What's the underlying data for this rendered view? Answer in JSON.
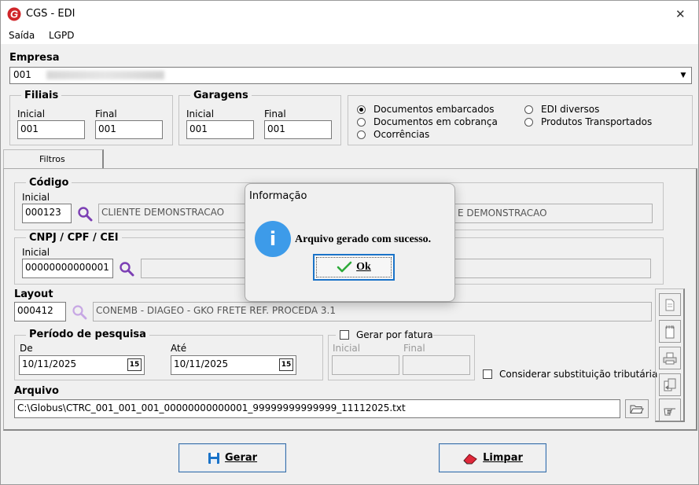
{
  "window": {
    "title": "CGS - EDI",
    "close_glyph": "✕"
  },
  "menu": [
    "Saída",
    "LGPD"
  ],
  "empresa": {
    "label": "Empresa",
    "value": "001"
  },
  "filiais": {
    "title": "Filiais",
    "inicial_label": "Inicial",
    "final_label": "Final",
    "inicial": "001",
    "final": "001"
  },
  "garagens": {
    "title": "Garagens",
    "inicial_label": "Inicial",
    "final_label": "Final",
    "inicial": "001",
    "final": "001"
  },
  "tipo": {
    "options": [
      "Documentos embarcados",
      "Documentos em cobrança",
      "Ocorrências",
      "EDI diversos",
      "Produtos Transportados"
    ],
    "selected": "Documentos embarcados"
  },
  "tab": {
    "label": "Filtros"
  },
  "codigo": {
    "title": "Código",
    "inicial_label": "Inicial",
    "inicial": "000123",
    "desc_inicial": "CLIENTE DEMONSTRACAO",
    "desc_final": "E DEMONSTRACAO"
  },
  "cnpj": {
    "title": "CNPJ / CPF / CEI",
    "inicial_label": "Inicial",
    "inicial": "00000000000001"
  },
  "layout": {
    "label": "Layout",
    "code": "000412",
    "desc": "CONEMB - DIAGEO - GKO FRETE REF. PROCEDA 3.1"
  },
  "periodo": {
    "title": "Período de pesquisa",
    "de_label": "De",
    "ate_label": "Até",
    "de": "10/11/2025",
    "ate": "10/11/2025",
    "cal_glyph": "15"
  },
  "fatura": {
    "label": "Gerar por fatura",
    "checked": false,
    "inicial_label": "Inicial",
    "final_label": "Final"
  },
  "substituicao": {
    "label": "Considerar substituição tributária",
    "checked": false
  },
  "arquivo": {
    "label": "Arquivo",
    "value": "C:\\Globus\\CTRC_001_001_001_00000000000001_99999999999999_11112025.txt"
  },
  "buttons": {
    "gerar": "Gerar",
    "limpar": "Limpar"
  },
  "dialog": {
    "title": "Informação",
    "message": "Arquivo gerado com sucesso.",
    "ok": "Ok",
    "icon_glyph": "i"
  },
  "colors": {
    "accent": "#1a73c8",
    "logo_red": "#d0262a",
    "dialog_icon": "#3d9be9",
    "search_icon": "#7c3fb4"
  }
}
